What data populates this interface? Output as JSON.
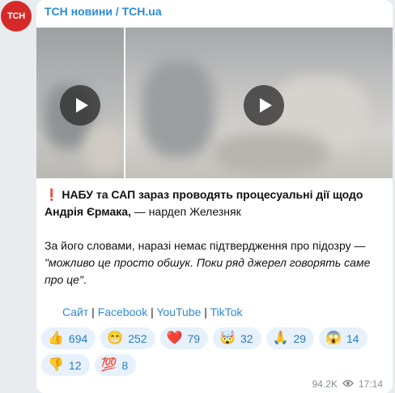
{
  "avatar": {
    "text": "ТСН"
  },
  "channel": {
    "name": "ТСН новини / TCH.ua"
  },
  "post": {
    "line1_mark": "❗",
    "line1_bold": "НАБУ та САП зараз проводять процесуальні дії щодо Андрія Єрмака,",
    "line1_rest": " — нардеп Железняк",
    "line2_plain": "За його словами, наразі немає підтвердження про підозру —",
    "line2_italic": "\"можливо це просто обшук. Поки ряд джерел говорять саме про це\"",
    "line2_end": "."
  },
  "links": {
    "site": "Сайт",
    "sep": " | ",
    "facebook": "Facebook",
    "youtube": "YouTube",
    "tiktok": "TikTok"
  },
  "reactions": [
    {
      "emoji": "👍",
      "count": "694"
    },
    {
      "emoji": "😁",
      "count": "252"
    },
    {
      "emoji": "❤️",
      "count": "79"
    },
    {
      "emoji": "🤯",
      "count": "32"
    },
    {
      "emoji": "🙏",
      "count": "29"
    },
    {
      "emoji": "😱",
      "count": "14"
    },
    {
      "emoji": "👎",
      "count": "12"
    },
    {
      "emoji": "💯",
      "count": "8"
    }
  ],
  "meta": {
    "views": "94.2K",
    "time": "17:14"
  },
  "colors": {
    "accent": "#2d8ad6",
    "avatar_bg": "#d62a2a",
    "reaction_bg": "#e6f1fb"
  },
  "icons": {
    "play": "play-icon",
    "views": "eye-icon"
  }
}
